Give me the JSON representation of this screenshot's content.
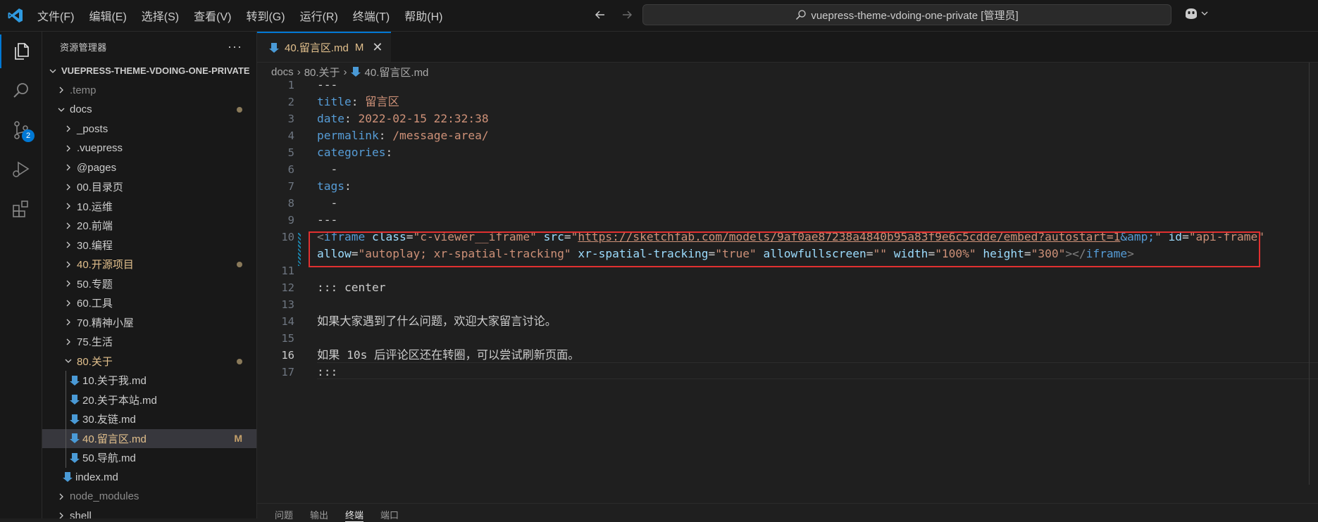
{
  "menu": [
    "文件(F)",
    "编辑(E)",
    "选择(S)",
    "查看(V)",
    "转到(G)",
    "运行(R)",
    "终端(T)",
    "帮助(H)"
  ],
  "search": {
    "text": "vuepress-theme-vdoing-one-private [管理员]"
  },
  "activity": {
    "scm_badge": "2"
  },
  "sidebar": {
    "title": "资源管理器",
    "more": "···",
    "root": "VUEPRESS-THEME-VDOING-ONE-PRIVATE",
    "items": [
      {
        "label": ".temp",
        "color": "#8b8b8b"
      },
      {
        "label": "docs",
        "color": "#cccccc"
      },
      {
        "label": "_posts",
        "color": "#cccccc"
      },
      {
        "label": ".vuepress",
        "color": "#cccccc"
      },
      {
        "label": "@pages",
        "color": "#cccccc"
      },
      {
        "label": "00.目录页",
        "color": "#cccccc"
      },
      {
        "label": "10.运维",
        "color": "#cccccc"
      },
      {
        "label": "20.前端",
        "color": "#cccccc"
      },
      {
        "label": "30.编程",
        "color": "#cccccc"
      },
      {
        "label": "40.开源项目",
        "color": "#e2c08d"
      },
      {
        "label": "50.专题",
        "color": "#cccccc"
      },
      {
        "label": "60.工具",
        "color": "#cccccc"
      },
      {
        "label": "70.精神小屋",
        "color": "#cccccc"
      },
      {
        "label": "75.生活",
        "color": "#cccccc"
      },
      {
        "label": "80.关于",
        "color": "#e2c08d"
      },
      {
        "label": "10.关于我.md",
        "color": "#cccccc"
      },
      {
        "label": "20.关于本站.md",
        "color": "#cccccc"
      },
      {
        "label": "30.友链.md",
        "color": "#cccccc"
      },
      {
        "label": "40.留言区.md",
        "color": "#e2c08d",
        "status": "M"
      },
      {
        "label": "50.导航.md",
        "color": "#cccccc"
      },
      {
        "label": "index.md",
        "color": "#cccccc"
      },
      {
        "label": "node_modules",
        "color": "#8b8b8b"
      },
      {
        "label": "shell",
        "color": "#cccccc"
      }
    ]
  },
  "tab": {
    "label": "40.留言区.md",
    "status": "M",
    "close": "✕"
  },
  "breadcrumb": [
    "docs",
    "80.关于",
    "40.留言区.md"
  ],
  "editor": {
    "line_numbers": [
      "1",
      "2",
      "3",
      "4",
      "5",
      "6",
      "7",
      "8",
      "9",
      "10",
      "11",
      "12",
      "13",
      "14",
      "15",
      "16",
      "17"
    ],
    "l1": "---",
    "l2_key": "title",
    "l2_val": "留言区",
    "l3_key": "date",
    "l3_val": "2022-02-15 22:32:38",
    "l4_key": "permalink",
    "l4_val": "/message-area/",
    "l5_key": "categories",
    "l6": "  -",
    "l7_key": "tags",
    "l8": "  -",
    "l9": "---",
    "l10_tag_open": "iframe",
    "l10_class_attr": "class",
    "l10_class_val": "\"c-viewer__iframe\"",
    "l10_src_attr": "src",
    "l10_src_q": "\"",
    "l10_src_url": "https://sketchfab.com/models/9af0ae87238a4840b95a83f9e6c5cdde/embed?autostart=1",
    "l10_amp": "&amp;",
    "l10_id_attr": "id",
    "l10_id_val": "\"api-frame\"",
    "l10b_allow_attr": "allow",
    "l10b_allow_val": "\"autoplay; xr-spatial-tracking\"",
    "l10b_xr_attr": "xr-spatial-tracking",
    "l10b_xr_val": "\"true\"",
    "l10b_fs_attr": "allowfullscreen",
    "l10b_fs_val": "\"\"",
    "l10b_w_attr": "width",
    "l10b_w_val": "\"100%\"",
    "l10b_h_attr": "height",
    "l10b_h_val": "\"300\"",
    "l10b_close_tag": "iframe",
    "l12": "::: center",
    "l14": "如果大家遇到了什么问题，欢迎大家留言讨论。",
    "l16": "如果 10s 后评论区还在转圈，可以尝试刷新页面。",
    "l17": ":::"
  },
  "panel": [
    "问题",
    "输出",
    "终端",
    "端口"
  ]
}
